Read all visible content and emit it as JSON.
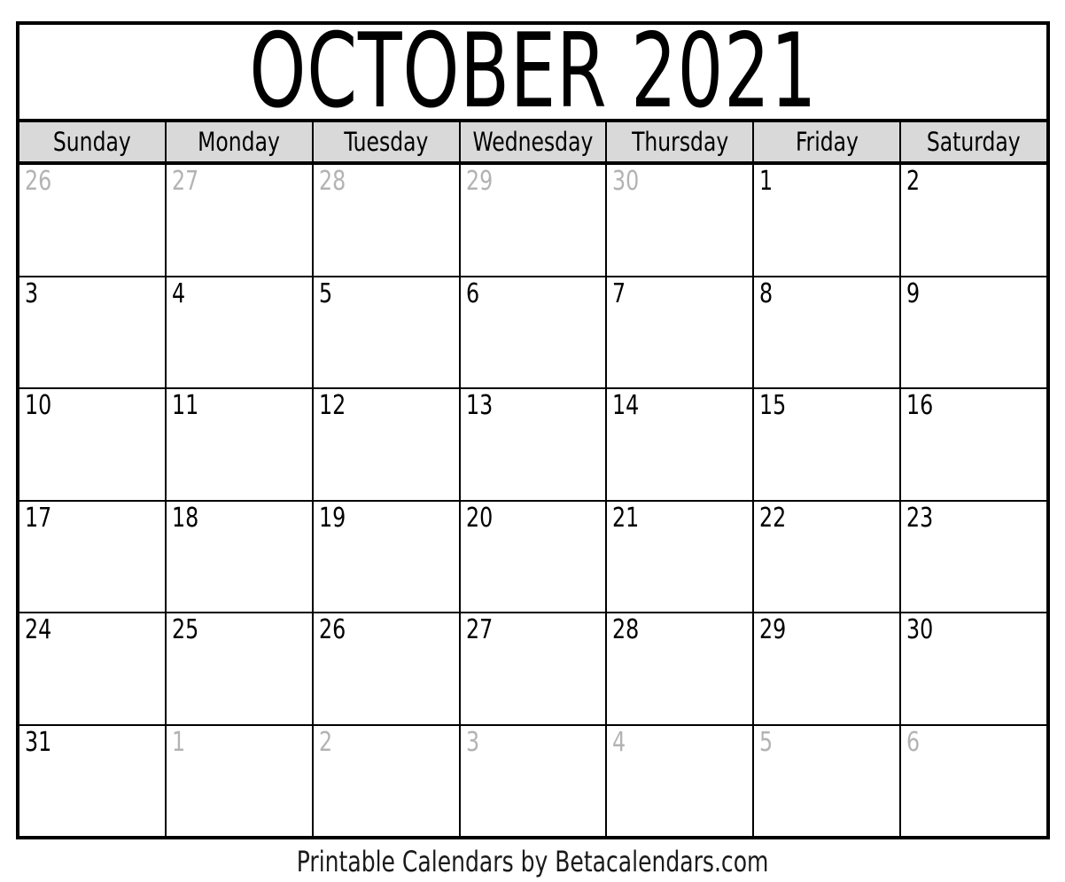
{
  "calendar": {
    "title": "OCTOBER 2021",
    "month_name": "October",
    "year": "2021",
    "weekdays": [
      "Sunday",
      "Monday",
      "Tuesday",
      "Wednesday",
      "Thursday",
      "Friday",
      "Saturday"
    ],
    "weeks": [
      [
        {
          "label": "26",
          "current_month": false
        },
        {
          "label": "27",
          "current_month": false
        },
        {
          "label": "28",
          "current_month": false
        },
        {
          "label": "29",
          "current_month": false
        },
        {
          "label": "30",
          "current_month": false
        },
        {
          "label": "1",
          "current_month": true
        },
        {
          "label": "2",
          "current_month": true
        }
      ],
      [
        {
          "label": "3",
          "current_month": true
        },
        {
          "label": "4",
          "current_month": true
        },
        {
          "label": "5",
          "current_month": true
        },
        {
          "label": "6",
          "current_month": true
        },
        {
          "label": "7",
          "current_month": true
        },
        {
          "label": "8",
          "current_month": true
        },
        {
          "label": "9",
          "current_month": true
        }
      ],
      [
        {
          "label": "10",
          "current_month": true
        },
        {
          "label": "11",
          "current_month": true
        },
        {
          "label": "12",
          "current_month": true
        },
        {
          "label": "13",
          "current_month": true
        },
        {
          "label": "14",
          "current_month": true
        },
        {
          "label": "15",
          "current_month": true
        },
        {
          "label": "16",
          "current_month": true
        }
      ],
      [
        {
          "label": "17",
          "current_month": true
        },
        {
          "label": "18",
          "current_month": true
        },
        {
          "label": "19",
          "current_month": true
        },
        {
          "label": "20",
          "current_month": true
        },
        {
          "label": "21",
          "current_month": true
        },
        {
          "label": "22",
          "current_month": true
        },
        {
          "label": "23",
          "current_month": true
        }
      ],
      [
        {
          "label": "24",
          "current_month": true
        },
        {
          "label": "25",
          "current_month": true
        },
        {
          "label": "26",
          "current_month": true
        },
        {
          "label": "27",
          "current_month": true
        },
        {
          "label": "28",
          "current_month": true
        },
        {
          "label": "29",
          "current_month": true
        },
        {
          "label": "30",
          "current_month": true
        }
      ],
      [
        {
          "label": "31",
          "current_month": true
        },
        {
          "label": "1",
          "current_month": false
        },
        {
          "label": "2",
          "current_month": false
        },
        {
          "label": "3",
          "current_month": false
        },
        {
          "label": "4",
          "current_month": false
        },
        {
          "label": "5",
          "current_month": false
        },
        {
          "label": "6",
          "current_month": false
        }
      ]
    ]
  },
  "footer": {
    "credit": "Printable Calendars by Betacalendars.com"
  },
  "colors": {
    "page_background": "#ffffff",
    "border": "#000000",
    "weekday_header_background": "#d9d9d9",
    "current_month_text": "#000000",
    "adjacent_month_text": "#b3b3b3",
    "footer_text": "#1a1a1a"
  }
}
